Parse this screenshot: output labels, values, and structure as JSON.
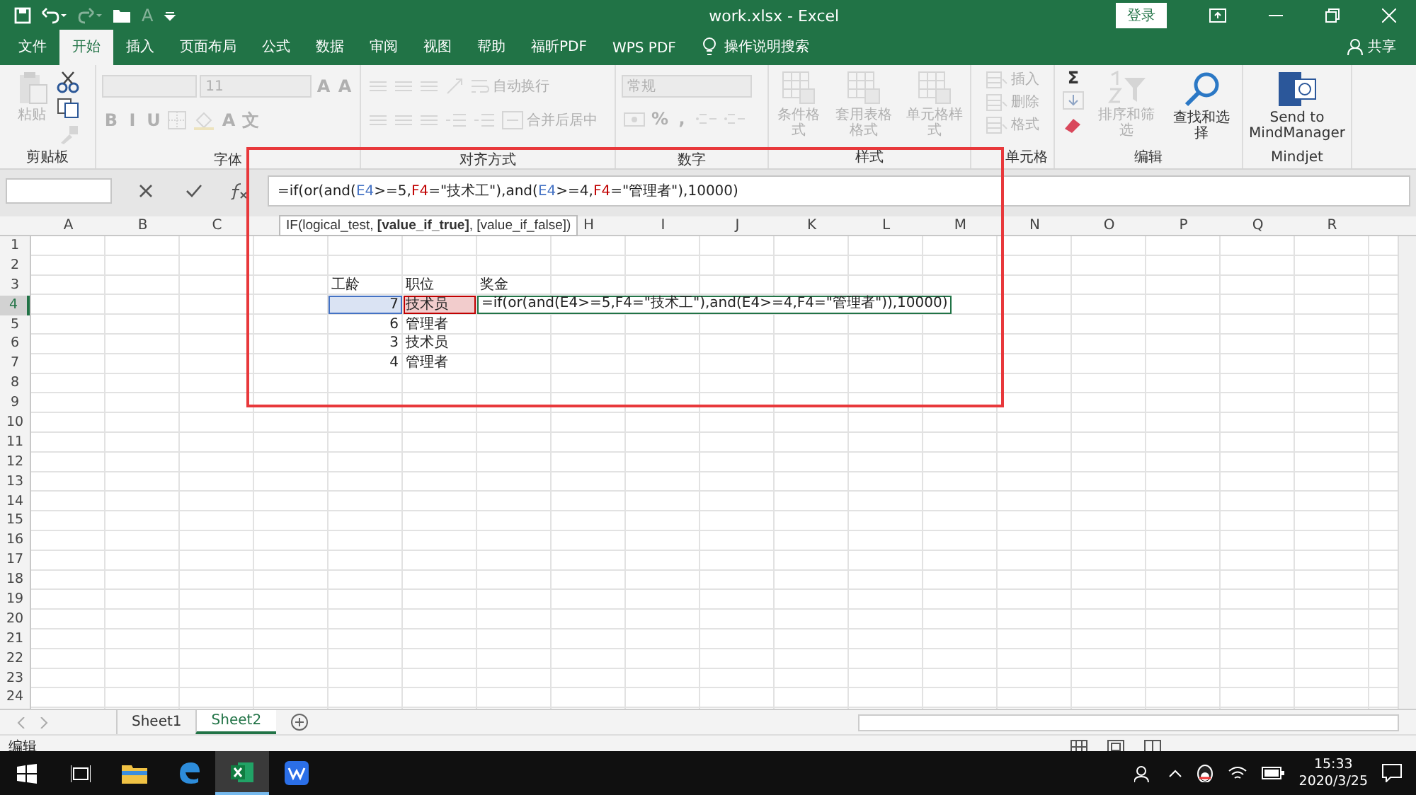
{
  "title_bar": {
    "quick_access": [
      {
        "kind": "save",
        "disabled": false
      },
      {
        "kind": "undo",
        "disabled": false
      },
      {
        "kind": "redo",
        "disabled": true
      },
      {
        "kind": "open",
        "disabled": false
      },
      {
        "kind": "glyph",
        "label": "A",
        "disabled": true
      },
      {
        "kind": "customize",
        "disabled": false
      }
    ],
    "title": "work.xlsx  -  Excel",
    "sign_in": "登录"
  },
  "tabs": [
    {
      "label": "文件",
      "selected": false
    },
    {
      "label": "开始",
      "selected": true
    },
    {
      "label": "插入",
      "selected": false
    },
    {
      "label": "页面布局",
      "selected": false
    },
    {
      "label": "公式",
      "selected": false
    },
    {
      "label": "数据",
      "selected": false
    },
    {
      "label": "审阅",
      "selected": false
    },
    {
      "label": "视图",
      "selected": false
    },
    {
      "label": "帮助",
      "selected": false
    },
    {
      "label": "福昕PDF",
      "selected": false
    },
    {
      "label": "WPS PDF",
      "selected": false
    }
  ],
  "tell_me": "操作说明搜索",
  "share": "共享",
  "ribbon": [
    {
      "title": "剪贴板",
      "columns": [
        [
          {
            "kind": "paste",
            "label": "粘贴",
            "disabled": true
          }
        ],
        [
          {
            "kind": "cut",
            "disabled": false
          },
          {
            "kind": "copy",
            "disabled": false
          },
          {
            "kind": "painter",
            "disabled": true
          }
        ]
      ]
    },
    {
      "title": "字体",
      "rows": [
        [
          {
            "kind": "combo",
            "disabled": true
          },
          {
            "kind": "combo",
            "label": "11",
            "disabled": true
          },
          {
            "kind": "glyph",
            "label": "A",
            "disabled": true
          },
          {
            "kind": "glyph",
            "label": "A",
            "disabled": true
          }
        ],
        [
          {
            "kind": "glyph",
            "label": "B",
            "disabled": true
          },
          {
            "kind": "glyph",
            "label": "I",
            "disabled": true
          },
          {
            "kind": "glyph",
            "label": "U",
            "disabled": true
          },
          {
            "kind": "border",
            "disabled": true
          },
          {
            "kind": "fill",
            "disabled": true
          },
          {
            "kind": "glyph",
            "label": "A",
            "disabled": true
          },
          {
            "kind": "glyph",
            "label": "文",
            "disabled": true
          }
        ]
      ]
    },
    {
      "title": "对齐方式",
      "rows": [
        [
          {
            "kind": "align",
            "disabled": true
          },
          {
            "kind": "align",
            "disabled": true
          },
          {
            "kind": "align",
            "disabled": true
          },
          {
            "kind": "orient",
            "disabled": true
          },
          {
            "kind": "wrap",
            "label": "自动换行",
            "disabled": true
          }
        ],
        [
          {
            "kind": "align",
            "disabled": true
          },
          {
            "kind": "align",
            "disabled": true
          },
          {
            "kind": "align",
            "disabled": true
          },
          {
            "kind": "indent",
            "disabled": true
          },
          {
            "kind": "indent",
            "disabled": true
          },
          {
            "kind": "merge",
            "label": "合并后居中",
            "disabled": true
          }
        ]
      ]
    },
    {
      "title": "数字",
      "rows": [
        [
          {
            "kind": "combo",
            "label": "常规",
            "disabled": true
          }
        ],
        [
          {
            "kind": "currency",
            "disabled": true
          },
          {
            "kind": "glyph",
            "label": "%",
            "disabled": true
          },
          {
            "kind": "glyph",
            "label": ",",
            "disabled": true
          },
          {
            "kind": "decimal",
            "disabled": true
          },
          {
            "kind": "decimal",
            "disabled": true
          }
        ]
      ]
    },
    {
      "title": "样式",
      "columns": [
        [
          {
            "kind": "large",
            "label": "条件格式",
            "disabled": true
          }
        ],
        [
          {
            "kind": "large",
            "label": "套用表格格式",
            "disabled": true
          }
        ],
        [
          {
            "kind": "large",
            "label": "单元格样式",
            "disabled": true
          }
        ]
      ]
    },
    {
      "title": "单元格",
      "columns": [
        [
          {
            "kind": "small",
            "label": "插入",
            "disabled": true
          },
          {
            "kind": "small",
            "label": "删除",
            "disabled": true
          },
          {
            "kind": "small",
            "label": "格式",
            "disabled": true
          }
        ]
      ]
    },
    {
      "title": "编辑",
      "columns": [
        [
          {
            "kind": "glyph",
            "label": "Σ",
            "disabled": false
          },
          {
            "kind": "filldown",
            "disabled": true
          },
          {
            "kind": "eraser",
            "disabled": false
          }
        ],
        [
          {
            "kind": "sort",
            "label": "排序和筛选",
            "disabled": true
          }
        ],
        [
          {
            "kind": "find",
            "label": "查找和选择",
            "disabled": false
          }
        ]
      ]
    },
    {
      "title": "Mindjet",
      "columns": [
        [
          {
            "kind": "mindmanager",
            "label": "Send to MindManager",
            "disabled": false
          }
        ]
      ]
    }
  ],
  "formula_bar": {
    "formula": [
      {
        "text": "=if(or(and("
      },
      {
        "text": "E4",
        "color": "#4472c4"
      },
      {
        "text": ">=5,"
      },
      {
        "text": "F4",
        "color": "#c00000"
      },
      {
        "text": "=\"技术工\"),and("
      },
      {
        "text": "E4",
        "color": "#4472c4"
      },
      {
        "text": ">=4,"
      },
      {
        "text": "F4",
        "color": "#c00000"
      },
      {
        "text": "=\"管理者\"),10000)"
      }
    ]
  },
  "tooltip": "IF(logical_test, **[value_if_true]**, [value_if_false])",
  "columns": [
    {
      "label": "A"
    },
    {
      "label": "B"
    },
    {
      "label": "C"
    },
    {},
    {},
    {},
    {},
    {
      "label": "H"
    },
    {
      "label": "I"
    },
    {
      "label": "J"
    },
    {
      "label": "K"
    },
    {
      "label": "L"
    },
    {
      "label": "M"
    },
    {
      "label": "N"
    },
    {
      "label": "O"
    },
    {
      "label": "P"
    },
    {
      "label": "Q"
    },
    {
      "label": "R"
    }
  ],
  "rows": [
    {
      "header": "1",
      "selected": false
    },
    {
      "header": "2",
      "selected": false
    },
    {
      "header": "3",
      "selected": false,
      "cells": [
        {
          "kind": "text",
          "text": "工龄"
        },
        {
          "kind": "text",
          "text": "职位"
        },
        {
          "kind": "text",
          "text": "奖金"
        }
      ]
    },
    {
      "header": "4",
      "selected": true,
      "cells": [
        {
          "kind": "number",
          "text": "7",
          "color": "#4472c4"
        },
        {
          "kind": "text",
          "text": "技术员",
          "color": "#c00000"
        },
        {
          "kind": "text",
          "text": "=if(or(and(E4>=5,F4=\"技术工\"),and(E4>=4,F4=\"管理者\")),10000)",
          "editing": true
        }
      ]
    },
    {
      "header": "5",
      "selected": false,
      "cells": [
        {
          "kind": "number",
          "text": "6"
        },
        {
          "kind": "text",
          "text": "管理者"
        }
      ]
    },
    {
      "header": "6",
      "selected": false,
      "cells": [
        {
          "kind": "number",
          "text": "3"
        },
        {
          "kind": "text",
          "text": "技术员"
        }
      ]
    },
    {
      "header": "7",
      "selected": false,
      "cells": [
        {
          "kind": "number",
          "text": "4"
        },
        {
          "kind": "text",
          "text": "管理者"
        }
      ]
    },
    {
      "header": "8",
      "selected": false
    },
    {
      "header": "9",
      "selected": false
    },
    {
      "header": "10",
      "selected": false
    },
    {
      "header": "11",
      "selected": false
    },
    {
      "header": "12",
      "selected": false
    },
    {
      "header": "13",
      "selected": false
    },
    {
      "header": "14",
      "selected": false
    },
    {
      "header": "15",
      "selected": false
    },
    {
      "header": "16",
      "selected": false
    },
    {
      "header": "17",
      "selected": false
    },
    {
      "header": "18",
      "selected": false
    },
    {
      "header": "19",
      "selected": false
    },
    {
      "header": "20",
      "selected": false
    },
    {
      "header": "21",
      "selected": false
    },
    {
      "header": "22",
      "selected": false
    },
    {
      "header": "23",
      "selected": false
    },
    {
      "header": "24",
      "selected": false
    }
  ],
  "sheets": [
    {
      "label": "Sheet1",
      "selected": false
    },
    {
      "label": "Sheet2",
      "selected": true
    }
  ],
  "status": "编辑",
  "taskbar": {
    "apps": [
      {
        "kind": "explorer",
        "selected": false
      },
      {
        "kind": "edge",
        "selected": false
      },
      {
        "kind": "excel",
        "selected": true
      },
      {
        "kind": "wps",
        "selected": false
      }
    ],
    "time": "15:33",
    "date": "2020/3/25"
  }
}
